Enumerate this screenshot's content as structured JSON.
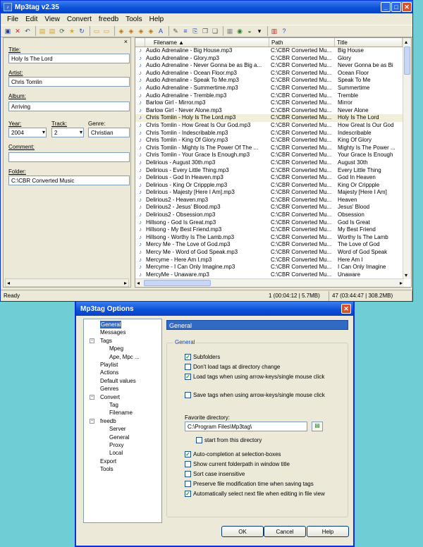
{
  "app": {
    "title": "Mp3tag v2.35",
    "menu": [
      "File",
      "Edit",
      "View",
      "Convert",
      "freedb",
      "Tools",
      "Help"
    ],
    "window_buttons": {
      "minimize": "_",
      "maximize": "□",
      "close": "✕"
    }
  },
  "tag_panel": {
    "title_label": "Title:",
    "title_value": "Holy Is The Lord",
    "artist_label": "Artist:",
    "artist_value": "Chris Tomlin",
    "album_label": "Album:",
    "album_value": "Arriving",
    "year_label": "Year:",
    "year_value": "2004",
    "track_label": "Track:",
    "track_value": "2",
    "genre_label": "Genre:",
    "genre_value": "Christian",
    "comment_label": "Comment:",
    "comment_value": "",
    "folder_label": "Folder:",
    "folder_value": "C:\\CBR Converted Music"
  },
  "file_list": {
    "columns": [
      "Filename",
      "Path",
      "Title"
    ],
    "selected_index": 9,
    "rows": [
      [
        "Audio Adrenaline - Big House.mp3",
        "C:\\CBR Converted Mu...",
        "Big House"
      ],
      [
        "Audio Adrenaline - Glory.mp3",
        "C:\\CBR Converted Mu...",
        "Glory"
      ],
      [
        "Audio Adrenaline - Never Gonna be as Big a...",
        "C:\\CBR Converted Mu...",
        "Never Gonna be as Bi"
      ],
      [
        "Audio Adrenaline - Ocean Floor.mp3",
        "C:\\CBR Converted Mu...",
        "Ocean Floor"
      ],
      [
        "Audio Adrenaline - Speak To Me.mp3",
        "C:\\CBR Converted Mu...",
        "Speak To Me"
      ],
      [
        "Audio Adrenaline - Summertime.mp3",
        "C:\\CBR Converted Mu...",
        "Summertime"
      ],
      [
        "Audio Adrenaline - Tremble.mp3",
        "C:\\CBR Converted Mu...",
        "Tremble"
      ],
      [
        "Barlow Girl - Mirror.mp3",
        "C:\\CBR Converted Mu...",
        "Mirror"
      ],
      [
        "Barlow Girl - Never Alone.mp3",
        "C:\\CBR Converted Mu...",
        "Never Alone"
      ],
      [
        "Chris Tomlin - Holy Is The Lord.mp3",
        "C:\\CBR Converted Mu...",
        "Holy Is The Lord"
      ],
      [
        "Chris Tomlin - How Great Is Our God.mp3",
        "C:\\CBR Converted Mu...",
        "How Great Is Our God"
      ],
      [
        "Chris Tomlin - Indescribable.mp3",
        "C:\\CBR Converted Mu...",
        "Indescribable"
      ],
      [
        "Chris Tomlin - King Of Glory.mp3",
        "C:\\CBR Converted Mu...",
        "King Of Glory"
      ],
      [
        "Chris Tomlin - Mighty Is The Power Of The ...",
        "C:\\CBR Converted Mu...",
        "Mighty Is The Power ..."
      ],
      [
        "Chris Tomlin - Your Grace Is Enough.mp3",
        "C:\\CBR Converted Mu...",
        "Your Grace Is Enough"
      ],
      [
        "Delirious - August 30th.mp3",
        "C:\\CBR Converted Mu...",
        "August 30th"
      ],
      [
        "Delirious - Every Little Thing.mp3",
        "C:\\CBR Converted Mu...",
        "Every Little Thing"
      ],
      [
        "Delirious - God In Heaven.mp3",
        "C:\\CBR Converted Mu...",
        "God In Heaven"
      ],
      [
        "Delirious - King Or Crippple.mp3",
        "C:\\CBR Converted Mu...",
        "King Or Crippple"
      ],
      [
        "Delirious - Majesty [Here I Am].mp3",
        "C:\\CBR Converted Mu...",
        "Majesty [Here I Am]"
      ],
      [
        "Delirious2 - Heaven.mp3",
        "C:\\CBR Converted Mu...",
        "Heaven"
      ],
      [
        "Delirious2 - Jesus' Blood.mp3",
        "C:\\CBR Converted Mu...",
        "Jesus' Blood"
      ],
      [
        "Delirious2 - Obsession.mp3",
        "C:\\CBR Converted Mu...",
        "Obsession"
      ],
      [
        "Hillsong - God Is Great.mp3",
        "C:\\CBR Converted Mu...",
        "God Is Great"
      ],
      [
        "Hillsong - My Best Friend.mp3",
        "C:\\CBR Converted Mu...",
        "My Best Friend"
      ],
      [
        "Hillsong - Worthy Is The Lamb.mp3",
        "C:\\CBR Converted Mu...",
        "Worthy Is The Lamb"
      ],
      [
        "Mercy Me - The Love of God.mp3",
        "C:\\CBR Converted Mu...",
        "The Love of God"
      ],
      [
        "Mercy Me - Word of God Speak.mp3",
        "C:\\CBR Converted Mu...",
        "Word of God Speak"
      ],
      [
        "Mercyme - Here Am I.mp3",
        "C:\\CBR Converted Mu...",
        "Here Am I"
      ],
      [
        "Mercyme - I Can Only Imagine.mp3",
        "C:\\CBR Converted Mu...",
        "I Can Only Imagine"
      ],
      [
        "MercyMe - Unaware.mp3",
        "C:\\CBR Converted Mu...",
        "Unaware"
      ]
    ]
  },
  "status": {
    "ready": "Ready",
    "selection": "1 (00:04:12 | 5.7MB)",
    "total": "47 (03:44:47 | 308.2MB)"
  },
  "options_dialog": {
    "title": "Mp3tag Options",
    "tree": [
      "General",
      "Messages",
      "Tags",
      "Mpeg",
      "Ape, Mpc ...",
      "Playlist",
      "Actions",
      "Default values",
      "Genres",
      "Convert",
      "Tag",
      "Filename",
      "freedb",
      "Server",
      "General",
      "Proxy",
      "Local",
      "Export",
      "Tools"
    ],
    "section_header": "General",
    "group_label": "General",
    "options": [
      {
        "label": "Subfolders",
        "checked": true
      },
      {
        "label": "Don't load tags at directory change",
        "checked": false
      },
      {
        "label": "Load tags when using arrow-keys/single mouse click",
        "checked": true
      },
      {
        "label": "Save tags when using arrow-keys/single mouse click",
        "checked": false
      }
    ],
    "favorite_label": "Favorite directory:",
    "favorite_value": "C:\\Program Files\\Mp3tag\\",
    "start_label": "start from this directory",
    "options2": [
      {
        "label": "Auto-completion at selection-boxes",
        "checked": true
      },
      {
        "label": "Show current folderpath in window title",
        "checked": false
      },
      {
        "label": "Sort case insensitive",
        "checked": false
      },
      {
        "label": "Preserve file modification time when saving tags",
        "checked": false
      },
      {
        "label": "Automatically select next file when editing in file view",
        "checked": true
      }
    ],
    "ok_label": "OK",
    "cancel_label": "Cancel",
    "help_label": "Help"
  }
}
